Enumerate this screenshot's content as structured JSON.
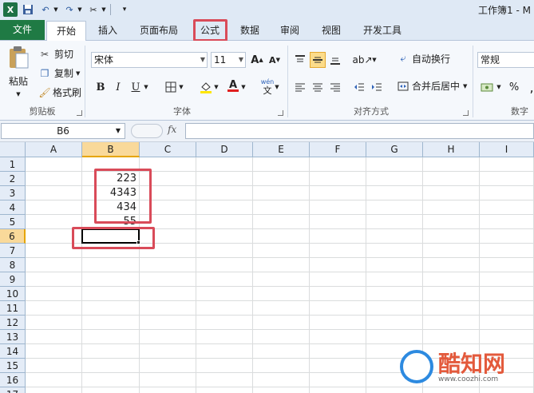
{
  "window": {
    "title": "工作簿1 - M"
  },
  "tabs": {
    "file": "文件",
    "home": "开始",
    "insert": "插入",
    "page_layout": "页面布局",
    "formulas": "公式",
    "data": "数据",
    "review": "审阅",
    "view": "视图",
    "developer": "开发工具"
  },
  "clipboard": {
    "paste": "粘贴",
    "cut": "剪切",
    "copy": "复制",
    "format_painter": "格式刷",
    "label": "剪贴板"
  },
  "font": {
    "name": "宋体",
    "size": "11",
    "label": "字体",
    "bold": "B",
    "italic": "I",
    "underline": "U",
    "wen": "wén",
    "zi": "文"
  },
  "alignment": {
    "wrap_text": "自动换行",
    "merge_center": "合并后居中",
    "label": "对齐方式"
  },
  "number": {
    "format": "常规",
    "label": "数字",
    "percent": "%"
  },
  "formula_bar": {
    "name_box": "B6",
    "fx": "fx",
    "content": ""
  },
  "sheet": {
    "columns": [
      "A",
      "B",
      "C",
      "D",
      "E",
      "F",
      "G",
      "H",
      "I"
    ],
    "selected_column": "B",
    "rows": [
      "1",
      "2",
      "3",
      "4",
      "5",
      "6",
      "7",
      "8",
      "9",
      "10",
      "11",
      "12",
      "13",
      "14",
      "15",
      "16",
      "17"
    ],
    "selected_row": "6",
    "active_cell": "B6",
    "cells": {
      "B2": "223",
      "B3": "4343",
      "B4": "434",
      "B5": "55"
    }
  },
  "watermark": {
    "brand": "酷知网",
    "url": "www.coozhi.com"
  },
  "colors": {
    "file_tab": "#1f7a44",
    "highlight_box": "#d94b59",
    "header_bg": "#e4ecf7",
    "selected_header": "#f9d99a"
  }
}
